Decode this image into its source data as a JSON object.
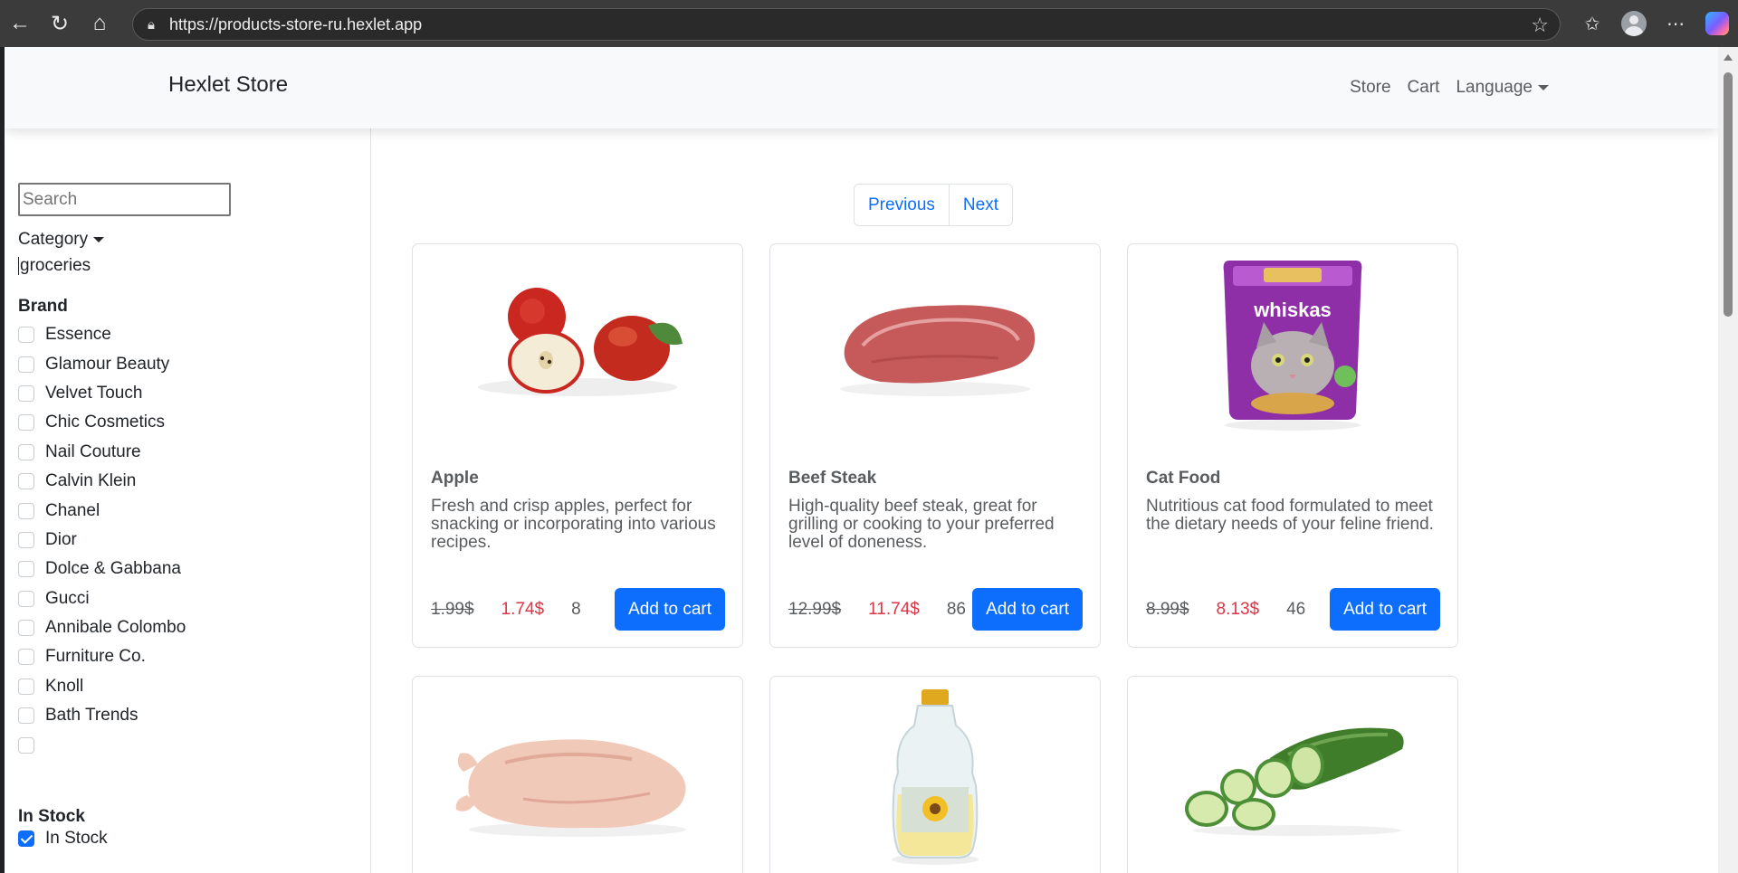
{
  "browser": {
    "url": "https://products-store-ru.hexlet.app",
    "icons": [
      "back-arrow-icon",
      "reload-icon",
      "home-icon",
      "lock-icon",
      "star-icon",
      "favorites-icon",
      "profile-icon",
      "more-icon",
      "copilot-icon"
    ]
  },
  "navbar": {
    "brand": "Hexlet Store",
    "links": {
      "store": "Store",
      "cart": "Cart",
      "language": "Language"
    }
  },
  "sidebar": {
    "search_placeholder": "Search",
    "category_label": "Category",
    "category_value": "groceries",
    "brand_title": "Brand",
    "brands": [
      "Essence",
      "Glamour Beauty",
      "Velvet Touch",
      "Chic Cosmetics",
      "Nail Couture",
      "Calvin Klein",
      "Chanel",
      "Dior",
      "Dolce & Gabbana",
      "Gucci",
      "Annibale Colombo",
      "Furniture Co.",
      "Knoll",
      "Bath Trends",
      ""
    ],
    "stock_title": "In Stock",
    "stock_label": "In Stock",
    "stock_checked": true
  },
  "pagination": {
    "previous": "Previous",
    "next": "Next"
  },
  "products": [
    {
      "title": "Apple",
      "description": "Fresh and crisp apples, perfect for snacking or incorporating into various recipes.",
      "old_price": "1.99$",
      "price": "1.74$",
      "stock": "8",
      "button": "Add to cart"
    },
    {
      "title": "Beef Steak",
      "description": "High-quality beef steak, great for grilling or cooking to your preferred level of doneness.",
      "old_price": "12.99$",
      "price": "11.74$",
      "stock": "86",
      "button": "Add to cart"
    },
    {
      "title": "Cat Food",
      "description": "Nutritious cat food formulated to meet the dietary needs of your feline friend.",
      "old_price": "8.99$",
      "price": "8.13$",
      "stock": "46",
      "button": "Add to cart"
    }
  ],
  "product_images": [
    "apple-image",
    "beef-steak-image",
    "cat-food-image",
    "chicken-image",
    "cooking-oil-image",
    "cucumber-image"
  ],
  "colors": {
    "primary": "#0d6efd",
    "sale": "#dc3545",
    "muted": "#595c5f",
    "navbar_bg": "#f8f9fa"
  },
  "package_text": "whiskas"
}
